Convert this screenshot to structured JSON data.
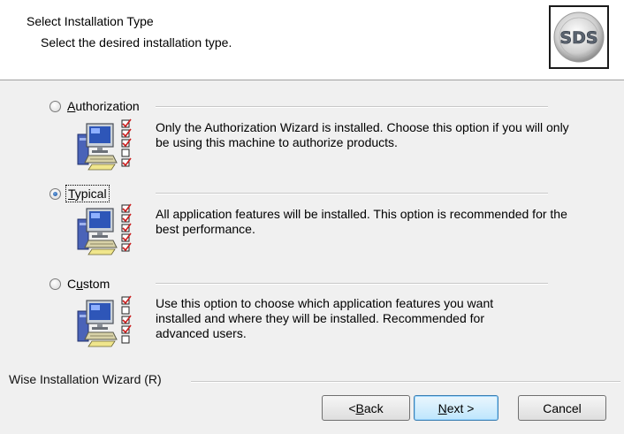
{
  "header": {
    "title": "Select Installation Type",
    "subtitle": "Select the desired installation type.",
    "logo_text": "SDS"
  },
  "options": [
    {
      "pre": "",
      "accel": "A",
      "post": "uthorization",
      "selected": false,
      "description": "Only the Authorization Wizard is installed. Choose this option if you will only be using this machine to authorize products.",
      "checkboxes": [
        true,
        true,
        true,
        false,
        true
      ]
    },
    {
      "pre": "",
      "accel": "T",
      "post": "ypical",
      "selected": true,
      "description": "All application features will be installed. This option is recommended for the best performance.",
      "checkboxes": [
        true,
        true,
        true,
        true,
        true
      ]
    },
    {
      "pre": "C",
      "accel": "u",
      "post": "stom",
      "selected": false,
      "description": "Use this option to choose which application features you want installed and where they will be installed. Recommended for advanced users.",
      "checkboxes": [
        true,
        false,
        true,
        true,
        false
      ]
    }
  ],
  "footer": {
    "brand": "Wise Installation Wizard (R)"
  },
  "buttons": {
    "back": {
      "pre": "< ",
      "accel": "B",
      "post": "ack"
    },
    "next": {
      "pre": "",
      "accel": "N",
      "post": "ext >"
    },
    "cancel": "Cancel"
  },
  "colors": {
    "window_bg": "#f0f0f0",
    "header_bg": "#ffffff",
    "check_mark": "#cc1f1f",
    "radio_dot": "#1b4f9c"
  }
}
